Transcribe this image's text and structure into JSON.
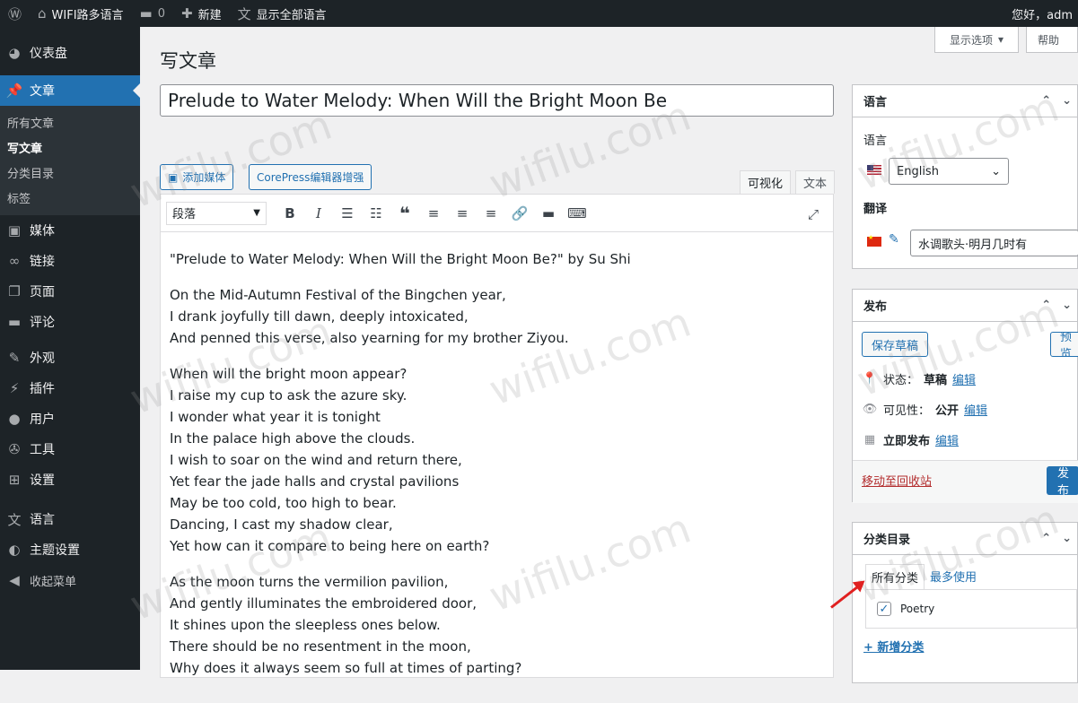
{
  "adminbar": {
    "site_name": "WIFI路多语言",
    "comments_count": "0",
    "new_label": "新建",
    "show_langs": "显示全部语言",
    "greeting": "您好，adm"
  },
  "sidebar": {
    "items": [
      {
        "label": "仪表盘",
        "icon": "dashboard-icon"
      },
      {
        "label": "文章",
        "icon": "pin-icon"
      },
      {
        "label": "媒体",
        "icon": "media-icon"
      },
      {
        "label": "链接",
        "icon": "link-icon"
      },
      {
        "label": "页面",
        "icon": "page-icon"
      },
      {
        "label": "评论",
        "icon": "comment-icon"
      },
      {
        "label": "外观",
        "icon": "brush-icon"
      },
      {
        "label": "插件",
        "icon": "plugin-icon"
      },
      {
        "label": "用户",
        "icon": "user-icon"
      },
      {
        "label": "工具",
        "icon": "wrench-icon"
      },
      {
        "label": "设置",
        "icon": "settings-icon"
      },
      {
        "label": "语言",
        "icon": "translate-icon"
      },
      {
        "label": "主题设置",
        "icon": "theme-icon"
      },
      {
        "label": "收起菜单",
        "icon": "collapse-icon"
      }
    ],
    "submenu": [
      "所有文章",
      "写文章",
      "分类目录",
      "标签"
    ]
  },
  "screen": {
    "options": "显示选项",
    "help": "帮助"
  },
  "page": {
    "title": "写文章",
    "post_title": "Prelude to Water Melody: When Will the Bright Moon Be"
  },
  "editor": {
    "add_media": "添加媒体",
    "corepress": "CorePress编辑器增强",
    "tab_visual": "可视化",
    "tab_text": "文本",
    "format": "段落",
    "paragraphs": [
      [
        "\"Prelude to Water Melody: When Will the Bright Moon Be?\" by Su Shi"
      ],
      [
        "On the Mid-Autumn Festival of the Bingchen year,",
        "I drank joyfully till dawn, deeply intoxicated,",
        "And penned this verse, also yearning for my brother Ziyou."
      ],
      [
        "When will the bright moon appear?",
        "I raise my cup to ask the azure sky.",
        "I wonder what year it is tonight",
        "In the palace high above the clouds.",
        "I wish to soar on the wind and return there,",
        "Yet fear the jade halls and crystal pavilions",
        "May be too cold, too high to bear.",
        "Dancing, I cast my shadow clear,",
        "Yet how can it compare to being here on earth?"
      ],
      [
        "As the moon turns the vermilion pavilion,",
        "And gently illuminates the embroidered door,",
        "It shines upon the sleepless ones below.",
        "There should be no resentment in the moon,",
        "Why does it always seem so full at times of parting?"
      ]
    ]
  },
  "language_box": {
    "title": "语言",
    "lang_label": "语言",
    "selected": "English",
    "translate_label": "翻译",
    "translation_value": "水调歌头·明月几时有"
  },
  "publish_box": {
    "title": "发布",
    "save_draft": "保存草稿",
    "preview": "预览",
    "status_label": "状态：",
    "status_value": "草稿",
    "visibility_label": "可见性：",
    "visibility_value": "公开",
    "publish_time": "立即发布",
    "edit": "编辑",
    "trash": "移动至回收站",
    "publish": "发布"
  },
  "category_box": {
    "title": "分类目录",
    "tab_all": "所有分类",
    "tab_popular": "最多使用",
    "category": "Poetry",
    "add_new": "+ 新增分类"
  },
  "watermark": "wifilu.com"
}
